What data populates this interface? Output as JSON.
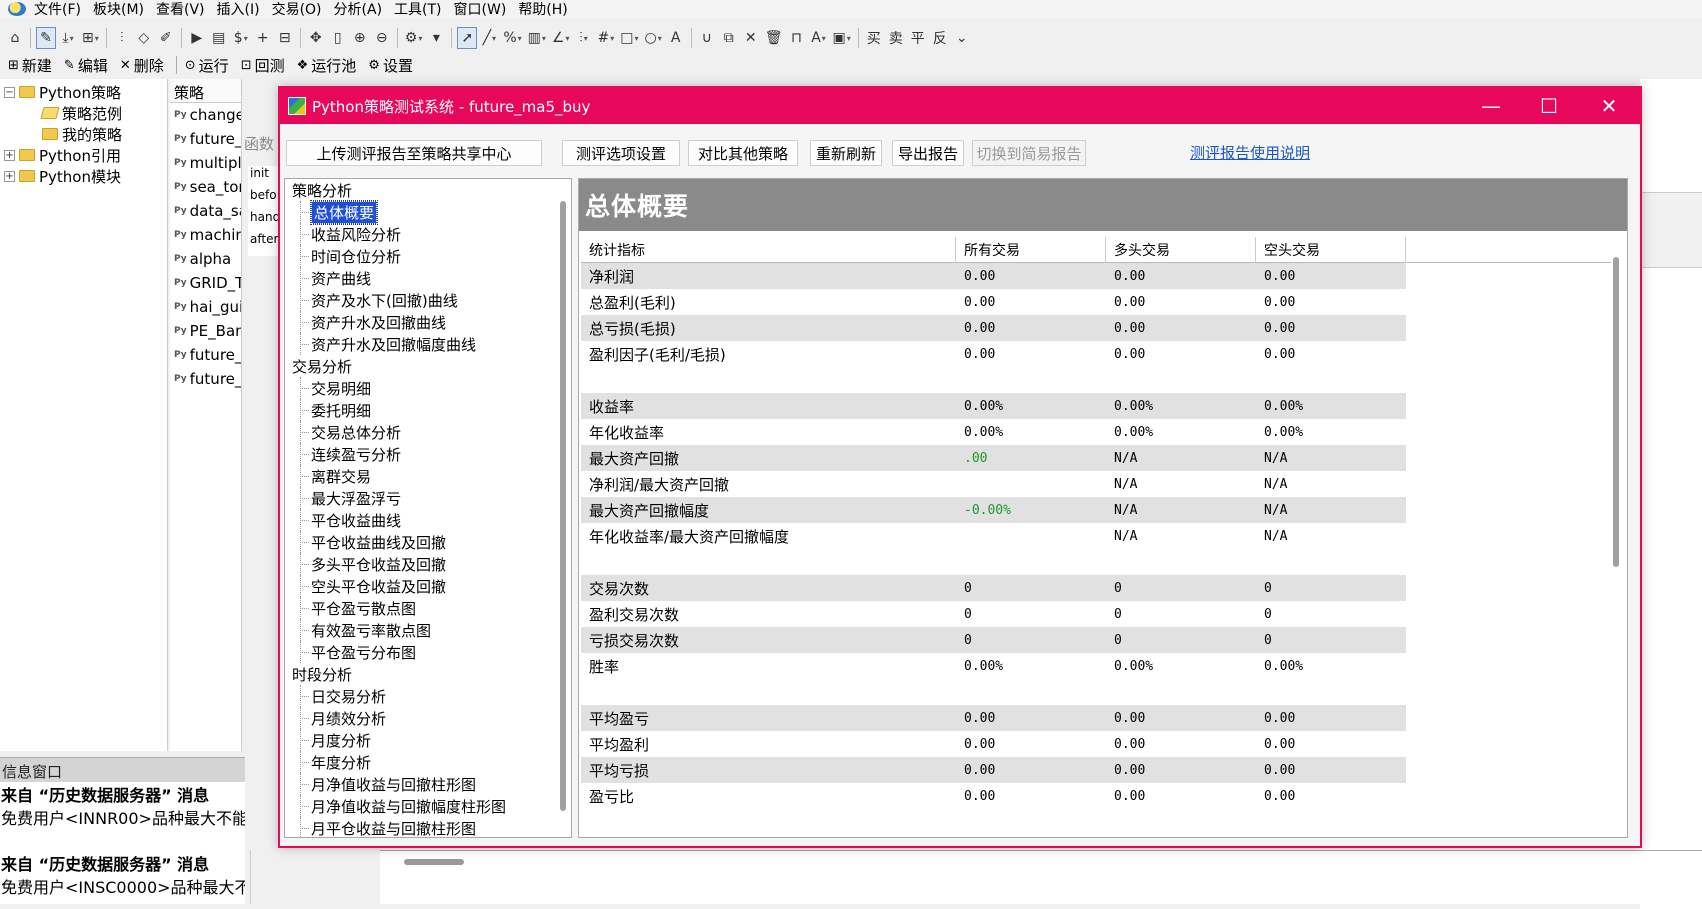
{
  "menu": [
    "文件(F)",
    "板块(M)",
    "查看(V)",
    "插入(I)",
    "交易(O)",
    "分析(A)",
    "工具(T)",
    "窗口(W)",
    "帮助(H)"
  ],
  "actions": {
    "new": "新建",
    "edit": "编辑",
    "delete": "删除",
    "run": "运行",
    "backtest": "回测",
    "run_pool": "运行池",
    "settings": "设置"
  },
  "tree": {
    "python_strategy": "Python策略",
    "strategy_examples": "策略范例",
    "my_strategies": "我的策略",
    "python_ref": "Python引用",
    "python_module": "Python模块"
  },
  "strategy_list": {
    "header": "策略",
    "items": [
      "change_hol",
      "future_",
      "multipl",
      "sea_tor",
      "data_sa",
      "machin",
      "alpha",
      "GRID_T",
      "hai_gui",
      "PE_Ban",
      "future_",
      "future_"
    ],
    "func_hint": "函数",
    "code_lines": [
      "init",
      "befo",
      "hand",
      "after"
    ]
  },
  "info_window": {
    "title": "信息窗口",
    "lines": [
      "来自 “历史数据服务器” 消息",
      "免费用户<INNR00>品种最大不能",
      "",
      "来自 “历史数据服务器” 消息",
      "免费用户<INSC0000>品种最大不"
    ]
  },
  "dialog": {
    "title": "Python策略测试系统 - future_ma5_buy",
    "buttons": {
      "upload": "上传测评报告至策略共享中心",
      "options": "测评选项设置",
      "compare": "对比其他策略",
      "refresh": "重新刷新",
      "export": "导出报告",
      "simple": "切换到简易报告"
    },
    "help_link": "测评报告使用说明",
    "nav": [
      {
        "type": "cat",
        "label": "策略分析"
      },
      {
        "type": "leaf",
        "label": "总体概要",
        "selected": true
      },
      {
        "type": "leaf",
        "label": "收益风险分析"
      },
      {
        "type": "leaf",
        "label": "时间仓位分析"
      },
      {
        "type": "leaf",
        "label": "资产曲线"
      },
      {
        "type": "leaf",
        "label": "资产及水下(回撤)曲线"
      },
      {
        "type": "leaf",
        "label": "资产升水及回撤曲线"
      },
      {
        "type": "leaf",
        "label": "资产升水及回撤幅度曲线"
      },
      {
        "type": "cat",
        "label": "交易分析"
      },
      {
        "type": "leaf",
        "label": "交易明细"
      },
      {
        "type": "leaf",
        "label": "委托明细"
      },
      {
        "type": "leaf",
        "label": "交易总体分析"
      },
      {
        "type": "leaf",
        "label": "连续盈亏分析"
      },
      {
        "type": "leaf",
        "label": "离群交易"
      },
      {
        "type": "leaf",
        "label": "最大浮盈浮亏"
      },
      {
        "type": "leaf",
        "label": "平仓收益曲线"
      },
      {
        "type": "leaf",
        "label": "平仓收益曲线及回撤"
      },
      {
        "type": "leaf",
        "label": "多头平仓收益及回撤"
      },
      {
        "type": "leaf",
        "label": "空头平仓收益及回撤"
      },
      {
        "type": "leaf",
        "label": "平仓盈亏散点图"
      },
      {
        "type": "leaf",
        "label": "有效盈亏率散点图"
      },
      {
        "type": "leaf",
        "label": "平仓盈亏分布图"
      },
      {
        "type": "cat",
        "label": "时段分析"
      },
      {
        "type": "leaf",
        "label": "日交易分析"
      },
      {
        "type": "leaf",
        "label": "月绩效分析"
      },
      {
        "type": "leaf",
        "label": "月度分析"
      },
      {
        "type": "leaf",
        "label": "年度分析"
      },
      {
        "type": "leaf",
        "label": "月净值收益与回撤柱形图"
      },
      {
        "type": "leaf",
        "label": "月净值收益与回撤幅度柱形图"
      },
      {
        "type": "leaf",
        "label": "月平仓收益与回撤柱形图"
      }
    ],
    "content_title": "总体概要",
    "table": {
      "headers": [
        "统计指标",
        "所有交易",
        "多头交易",
        "空头交易"
      ],
      "rows": [
        {
          "label": "净利润",
          "all": "0.00",
          "long": "0.00",
          "short": "0.00"
        },
        {
          "label": "总盈利(毛利)",
          "all": "0.00",
          "long": "0.00",
          "short": "0.00"
        },
        {
          "label": "总亏损(毛损)",
          "all": "0.00",
          "long": "0.00",
          "short": "0.00"
        },
        {
          "label": "盈利因子(毛利/毛损)",
          "all": "0.00",
          "long": "0.00",
          "short": "0.00"
        },
        null,
        {
          "label": "收益率",
          "all": "0.00%",
          "long": "0.00%",
          "short": "0.00%"
        },
        {
          "label": "年化收益率",
          "all": "0.00%",
          "long": "0.00%",
          "short": "0.00%"
        },
        {
          "label": "最大资产回撤",
          "all": ".00",
          "long": "N/A",
          "short": "N/A",
          "green": true
        },
        {
          "label": "净利润/最大资产回撤",
          "all": "",
          "long": "N/A",
          "short": "N/A"
        },
        {
          "label": "最大资产回撤幅度",
          "all": "-0.00%",
          "long": "N/A",
          "short": "N/A",
          "green": true
        },
        {
          "label": "年化收益率/最大资产回撤幅度",
          "all": "",
          "long": "N/A",
          "short": "N/A"
        },
        null,
        {
          "label": "交易次数",
          "all": "0",
          "long": "0",
          "short": "0"
        },
        {
          "label": "盈利交易次数",
          "all": "0",
          "long": "0",
          "short": "0"
        },
        {
          "label": "亏损交易次数",
          "all": "0",
          "long": "0",
          "short": "0"
        },
        {
          "label": "胜率",
          "all": "0.00%",
          "long": "0.00%",
          "short": "0.00%"
        },
        null,
        {
          "label": "平均盈亏",
          "all": "0.00",
          "long": "0.00",
          "short": "0.00"
        },
        {
          "label": "平均盈利",
          "all": "0.00",
          "long": "0.00",
          "short": "0.00"
        },
        {
          "label": "平均亏损",
          "all": "0.00",
          "long": "0.00",
          "short": "0.00"
        },
        {
          "label": "盈亏比",
          "all": "0.00",
          "long": "0.00",
          "short": "0.00"
        }
      ]
    }
  },
  "colors": {
    "dialog_accent": "#e8085b",
    "content_header": "#8a8a8a",
    "selection": "#1f4fd6",
    "positive": "#1a9a2a",
    "link": "#1a57c8"
  }
}
